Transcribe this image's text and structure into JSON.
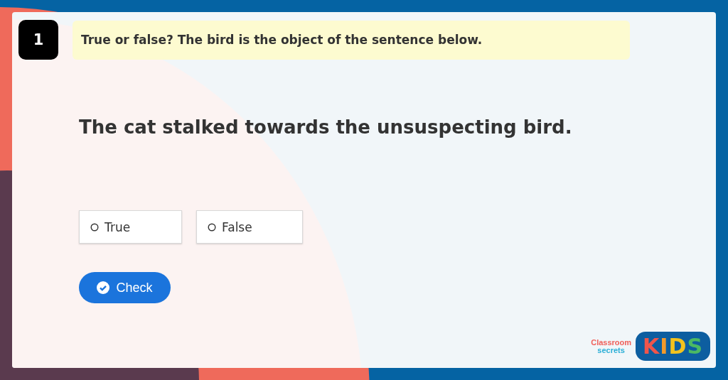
{
  "question": {
    "number": "1",
    "instruction": "True or false? The bird is the object of the sentence below.",
    "sentence": "The cat stalked towards the unsuspecting bird."
  },
  "options": [
    {
      "label": "True",
      "selected": false
    },
    {
      "label": "False",
      "selected": false
    }
  ],
  "check_button": {
    "label": "Check"
  },
  "logo": {
    "line_1": "Classroom",
    "line_2": "secrets",
    "kids_letters": [
      {
        "text": "K",
        "color": "#f0554b"
      },
      {
        "text": "I",
        "color": "#f39a2b"
      },
      {
        "text": "D",
        "color": "#f3c21d"
      },
      {
        "text": "S",
        "color": "#4cb963"
      }
    ]
  }
}
